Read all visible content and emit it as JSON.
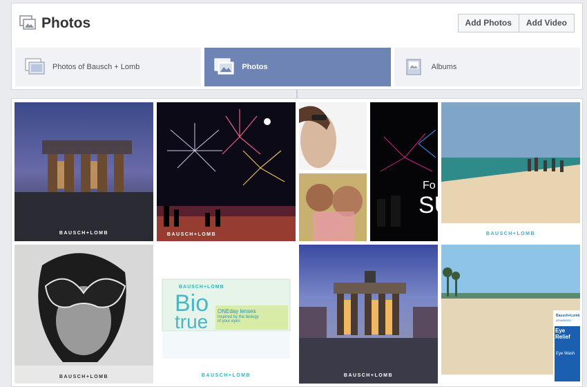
{
  "header": {
    "title": "Photos",
    "title_icon": "photos-icon",
    "add_photos_label": "Add Photos",
    "add_video_label": "Add Video"
  },
  "tabs": [
    {
      "label": "Photos of Bausch + Lomb",
      "icon": "photos-of-icon",
      "active": false
    },
    {
      "label": "Photos",
      "icon": "photos-icon",
      "active": true
    },
    {
      "label": "Albums",
      "icon": "albums-icon",
      "active": false
    }
  ],
  "photos": {
    "watermark": "BAUSCH+LOMB",
    "overlay_text_fireworks": "Fo",
    "overlay_text_fireworks2": "SU",
    "biotrue": {
      "brand": "BAUSCH+LOMB",
      "line1": "Bio",
      "line2": "true",
      "tagline": "ONEday lenses",
      "sub": "inspired by the biology of your eyes"
    },
    "eye_relief": {
      "brand": "Bausch+Lomb",
      "advanced": "ADVANCED",
      "product": "Eye Relief",
      "sub": "Eye Wash"
    }
  },
  "colors": {
    "active_tab": "#6d84b4",
    "tab_bg": "#f1f2f5",
    "card_border": "#d3d6db"
  }
}
